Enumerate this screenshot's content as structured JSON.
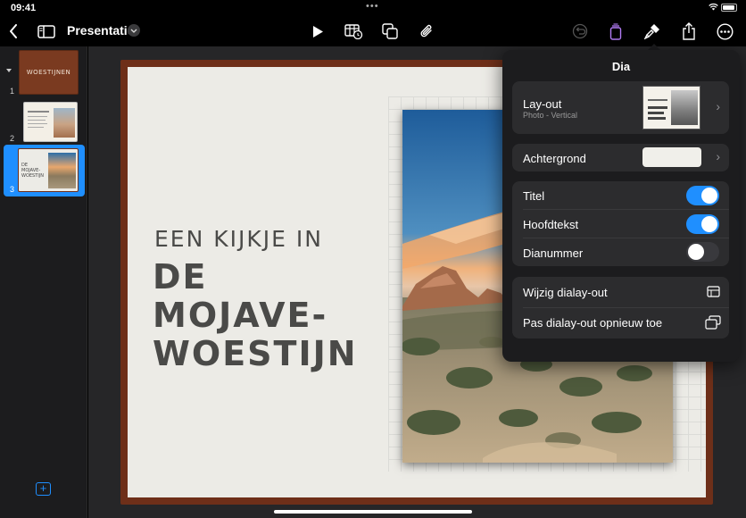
{
  "status": {
    "time": "09:41",
    "dots": "•••"
  },
  "toolbar": {
    "document_title": "Presentatie"
  },
  "sidebar": {
    "slides": [
      {
        "number": "1",
        "thumb_text": "WOESTIJNEN"
      },
      {
        "number": "2"
      },
      {
        "number": "3",
        "thumb_text": "DE MOJAVE-WOESTIJN"
      }
    ],
    "selected": "3"
  },
  "slide": {
    "subtitle": "EEN KIJKJE IN",
    "title": "DE MOJAVE-WOESTIJN"
  },
  "popover": {
    "title": "Dia",
    "layout": {
      "label": "Lay-out",
      "value": "Photo - Vertical"
    },
    "background": {
      "label": "Achtergrond"
    },
    "toggles": [
      {
        "label": "Titel",
        "on": true
      },
      {
        "label": "Hoofdtekst",
        "on": true
      },
      {
        "label": "Dianummer",
        "on": false
      }
    ],
    "actions": [
      {
        "label": "Wijzig dialay-out"
      },
      {
        "label": "Pas dialay-out opnieuw toe"
      }
    ]
  },
  "colors": {
    "accent": "#1f8fff",
    "slide_border": "#6e2f19",
    "slide_background": "#ecebe6",
    "popover_background": "#1c1c1e"
  }
}
